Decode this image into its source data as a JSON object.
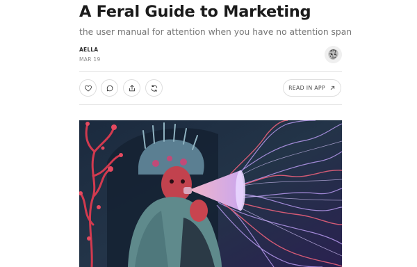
{
  "post": {
    "title": "A Feral Guide to Marketing",
    "subtitle": "the user manual for attention when you have no attention span",
    "author": "AELLA",
    "date": "MAR 19"
  },
  "actions": {
    "read_in_app": "READ IN APP",
    "icons": [
      "heart-icon",
      "comment-icon",
      "share-icon",
      "restack-icon",
      "arrow-up-right-icon"
    ]
  },
  "colors": {
    "text": "#1b1b1b",
    "muted": "#757575",
    "border": "#dedede",
    "hero_purple": "#a98be8",
    "hero_red": "#e0455a",
    "hero_teal": "#4f7f86"
  }
}
